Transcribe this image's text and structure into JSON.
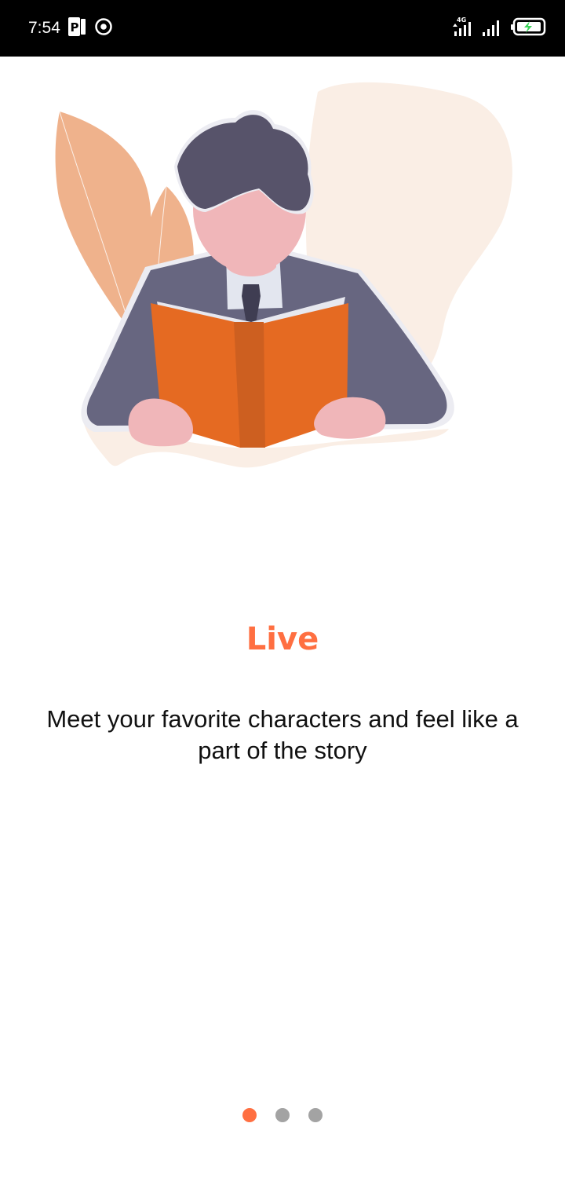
{
  "status_bar": {
    "time": "7:54",
    "network_label": "4G",
    "icons": [
      "parking-app-icon",
      "media-record-icon",
      "signal-4g-icon",
      "signal-bars-icon",
      "battery-charging-icon"
    ]
  },
  "onboarding": {
    "title": "Live",
    "description": "Meet your favorite characters and feel like a part of the story",
    "illustration": "man-reading-book-illustration"
  },
  "pager": {
    "pages": 3,
    "active_index": 0
  },
  "colors": {
    "accent": "#ff6f41",
    "dot_inactive": "#a3a3a3",
    "book": "#e56a22",
    "leaf": "#efb28c",
    "blob": "#faeee5",
    "suit": "#676680",
    "hair": "#57536a",
    "skin": "#f0b6b9"
  }
}
